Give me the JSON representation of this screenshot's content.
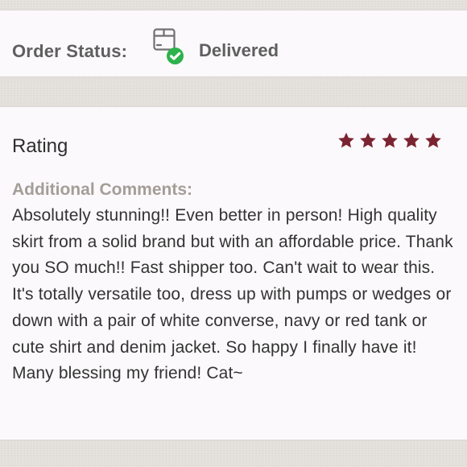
{
  "order_status": {
    "label": "Order Status:",
    "value": "Delivered",
    "icon": "package-delivered-icon",
    "status_color": "#2eb24d"
  },
  "rating": {
    "title": "Rating",
    "stars": 5,
    "max_stars": 5,
    "star_color": "#7b2431"
  },
  "comments": {
    "label": "Additional Comments:",
    "text": "Absolutely stunning!! Even better in person! High quality skirt from a solid brand but with an affordable price. Thank you SO much!! Fast shipper too. Can't wait to wear this. It's totally versatile too, dress up with pumps or wedges or down with a pair of white converse, navy or red tank or cute shirt and denim jacket. So happy I finally have it! Many blessing my friend! Cat~"
  }
}
